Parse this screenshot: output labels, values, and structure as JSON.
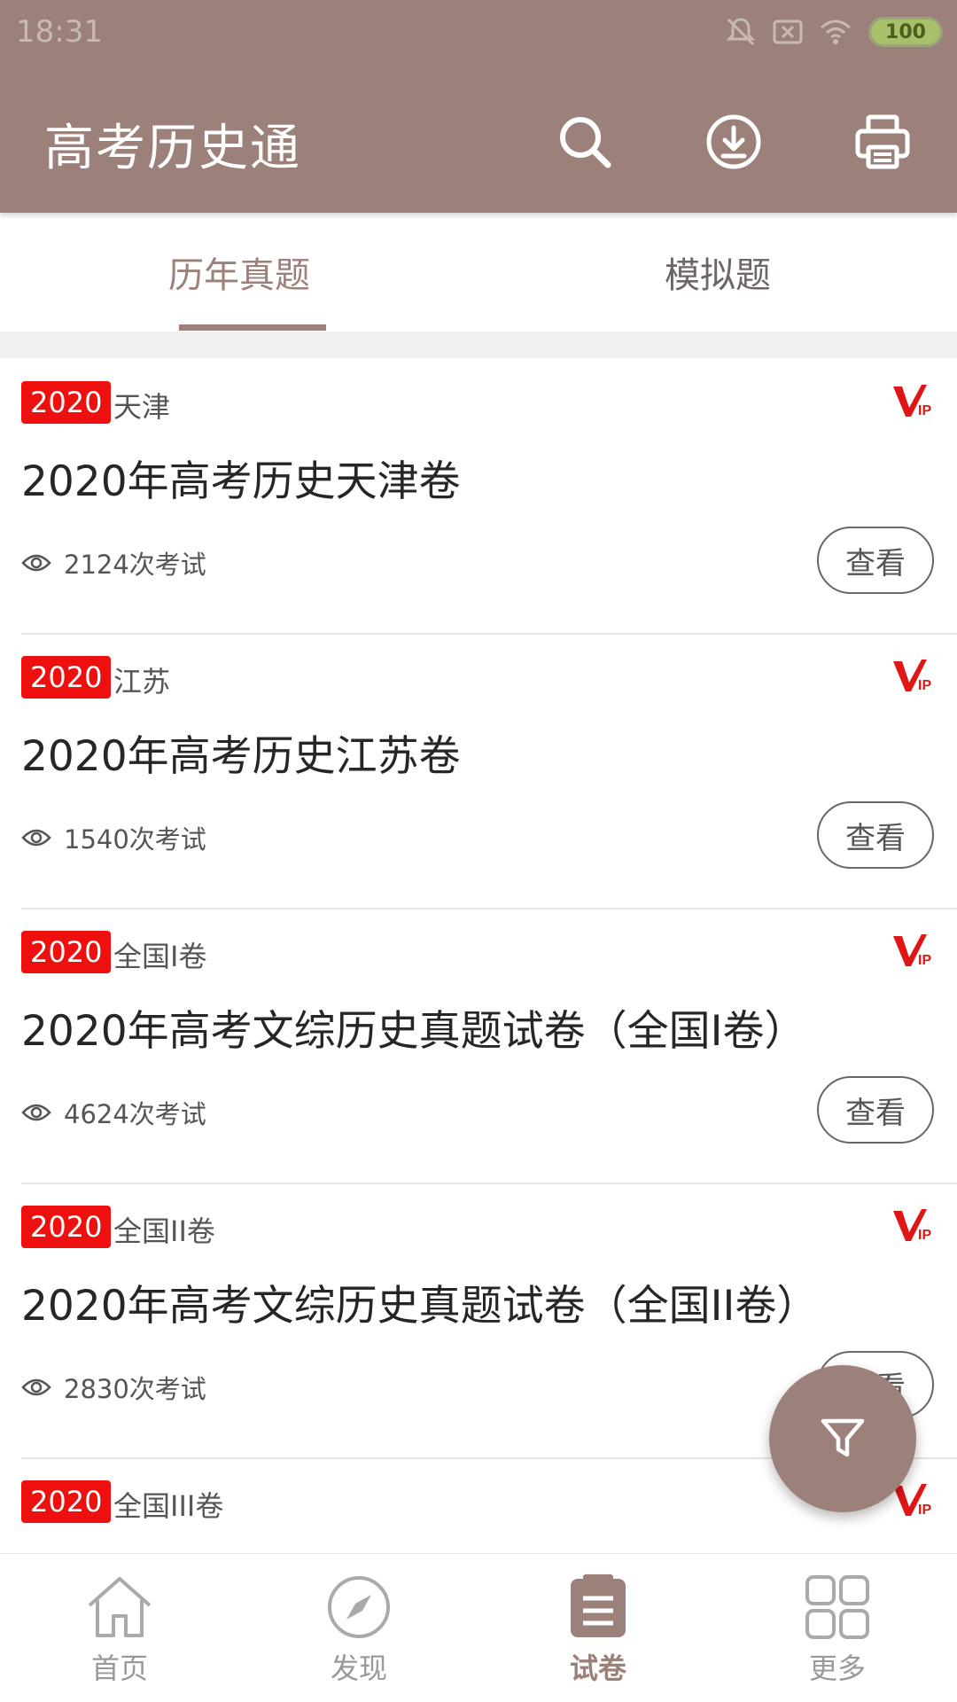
{
  "status": {
    "time": "18:31",
    "battery": "100"
  },
  "header": {
    "title": "高考历史通"
  },
  "icons": {
    "search": "search-icon",
    "download": "download-icon",
    "print": "printer-icon",
    "filter": "filter-icon",
    "eye": "eye-icon",
    "vip": "vip-icon"
  },
  "colors": {
    "brand": "#9b8179",
    "badge_red": "#ee0f0f"
  },
  "tabs": [
    {
      "label": "历年真题",
      "active": true
    },
    {
      "label": "模拟题",
      "active": false
    }
  ],
  "papers": [
    {
      "year": "2020",
      "region": "天津",
      "title": "2020年高考历史天津卷",
      "views": "2124次考试",
      "action": "查看"
    },
    {
      "year": "2020",
      "region": "江苏",
      "title": "2020年高考历史江苏卷",
      "views": "1540次考试",
      "action": "查看"
    },
    {
      "year": "2020",
      "region": "全国I卷",
      "title": "2020年高考文综历史真题试卷（全国I卷）",
      "views": "4624次考试",
      "action": "查看"
    },
    {
      "year": "2020",
      "region": "全国II卷",
      "title": "2020年高考文综历史真题试卷（全国II卷）",
      "views": "2830次考试",
      "action": "查看"
    },
    {
      "year": "2020",
      "region": "全国III卷"
    }
  ],
  "nav": [
    {
      "label": "首页",
      "active": false
    },
    {
      "label": "发现",
      "active": false
    },
    {
      "label": "试卷",
      "active": true
    },
    {
      "label": "更多",
      "active": false
    }
  ]
}
